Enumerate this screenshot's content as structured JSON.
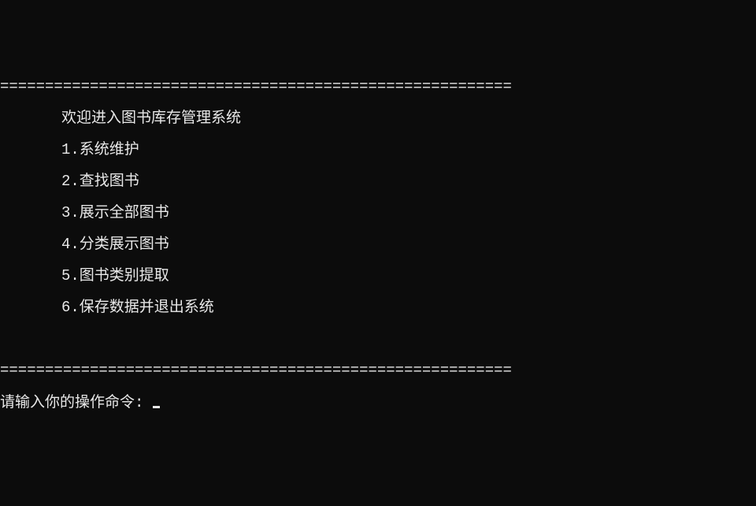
{
  "divider_top": "=========================================================",
  "title": "欢迎进入图书库存管理系统",
  "menu": [
    {
      "label": "1.系统维护"
    },
    {
      "label": "2.查找图书"
    },
    {
      "label": "3.展示全部图书"
    },
    {
      "label": "4.分类展示图书"
    },
    {
      "label": "5.图书类别提取"
    },
    {
      "label": "6.保存数据并退出系统"
    }
  ],
  "divider_bottom": "=========================================================",
  "prompt": "请输入你的操作命令:",
  "input_value": ""
}
